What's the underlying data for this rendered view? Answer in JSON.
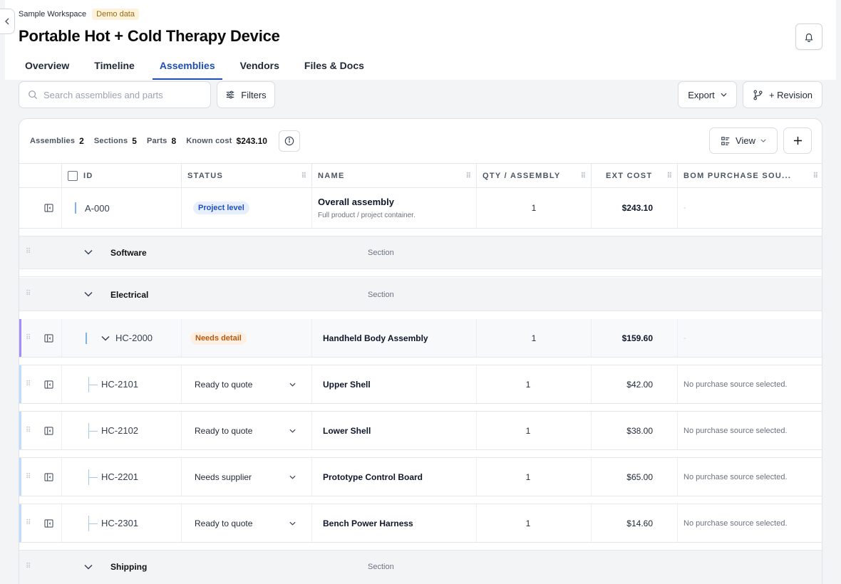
{
  "breadcrumb": {
    "workspace": "Sample Workspace",
    "badge": "Demo data"
  },
  "page": {
    "title": "Portable Hot + Cold Therapy Device"
  },
  "tabs": [
    "Overview",
    "Timeline",
    "Assemblies",
    "Vendors",
    "Files & Docs"
  ],
  "active_tab": "Assemblies",
  "toolbar": {
    "search_placeholder": "Search assemblies and parts",
    "filters": "Filters",
    "export": "Export",
    "revision": "+ Revision"
  },
  "summary": {
    "assemblies_label": "Assemblies",
    "assemblies": "2",
    "sections_label": "Sections",
    "sections": "5",
    "parts_label": "Parts",
    "parts": "8",
    "cost_label": "Known cost",
    "cost": "$243.10"
  },
  "view_label": "View",
  "columns": {
    "id": "ID",
    "status": "STATUS",
    "name": "NAME",
    "qty": "QTY / ASSEMBLY",
    "cost": "EXT COST",
    "source": "BOM PURCHASE SOU..."
  },
  "top_row": {
    "id": "A-000",
    "status": "Project level",
    "name": "Overall assembly",
    "desc": "Full product / project container.",
    "qty": "1",
    "cost": "$243.10",
    "source": "-"
  },
  "section_label": "Section",
  "sections": {
    "software": "Software",
    "electrical": "Electrical",
    "shipping": "Shipping"
  },
  "assembly": {
    "id": "HC-2000",
    "status": "Needs detail",
    "name": "Handheld Body Assembly",
    "qty": "1",
    "cost": "$159.60",
    "source": "-"
  },
  "parts": [
    {
      "id": "HC-2101",
      "status": "Ready to quote",
      "name": "Upper Shell",
      "qty": "1",
      "cost": "$42.00",
      "source": "No purchase source selected."
    },
    {
      "id": "HC-2102",
      "status": "Ready to quote",
      "name": "Lower Shell",
      "qty": "1",
      "cost": "$38.00",
      "source": "No purchase source selected."
    },
    {
      "id": "HC-2201",
      "status": "Needs supplier",
      "name": "Prototype Control Board",
      "qty": "1",
      "cost": "$65.00",
      "source": "No purchase source selected."
    },
    {
      "id": "HC-2301",
      "status": "Ready to quote",
      "name": "Bench Power Harness",
      "qty": "1",
      "cost": "$14.60",
      "source": "No purchase source selected."
    }
  ],
  "colors": {
    "accent": "#1f4fb6",
    "assembly_bar": "#a78bfa",
    "part_bar": "#bfdbfe"
  }
}
